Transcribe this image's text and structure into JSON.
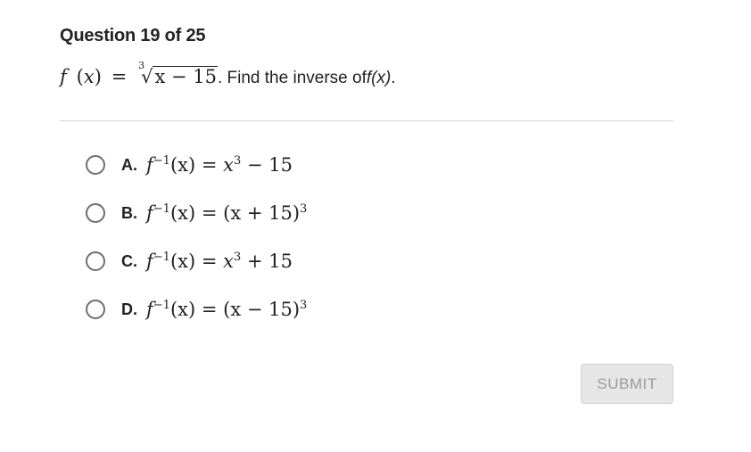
{
  "header": {
    "question_counter": "Question 19 of 25"
  },
  "prompt": {
    "function_name": "f",
    "variable": "x",
    "equals": "=",
    "root_index": "3",
    "radicand": "x − 15",
    "text": ". Find the inverse of ",
    "target": "f(x)",
    "end": "."
  },
  "options": [
    {
      "letter": "A.",
      "lhs": "f",
      "sup": "−1",
      "arg": "(x) = ",
      "body": "x",
      "body_sup": "3",
      "tail": " − 15"
    },
    {
      "letter": "B.",
      "lhs": "f",
      "sup": "−1",
      "arg": "(x) = ",
      "body": "(x + 15)",
      "body_sup": "3",
      "tail": ""
    },
    {
      "letter": "C.",
      "lhs": "f",
      "sup": "−1",
      "arg": "(x) = ",
      "body": "x",
      "body_sup": "3",
      "tail": " + 15"
    },
    {
      "letter": "D.",
      "lhs": "f",
      "sup": "−1",
      "arg": "(x) = ",
      "body": "(x − 15)",
      "body_sup": "3",
      "tail": ""
    }
  ],
  "submit": {
    "label": "SUBMIT"
  }
}
